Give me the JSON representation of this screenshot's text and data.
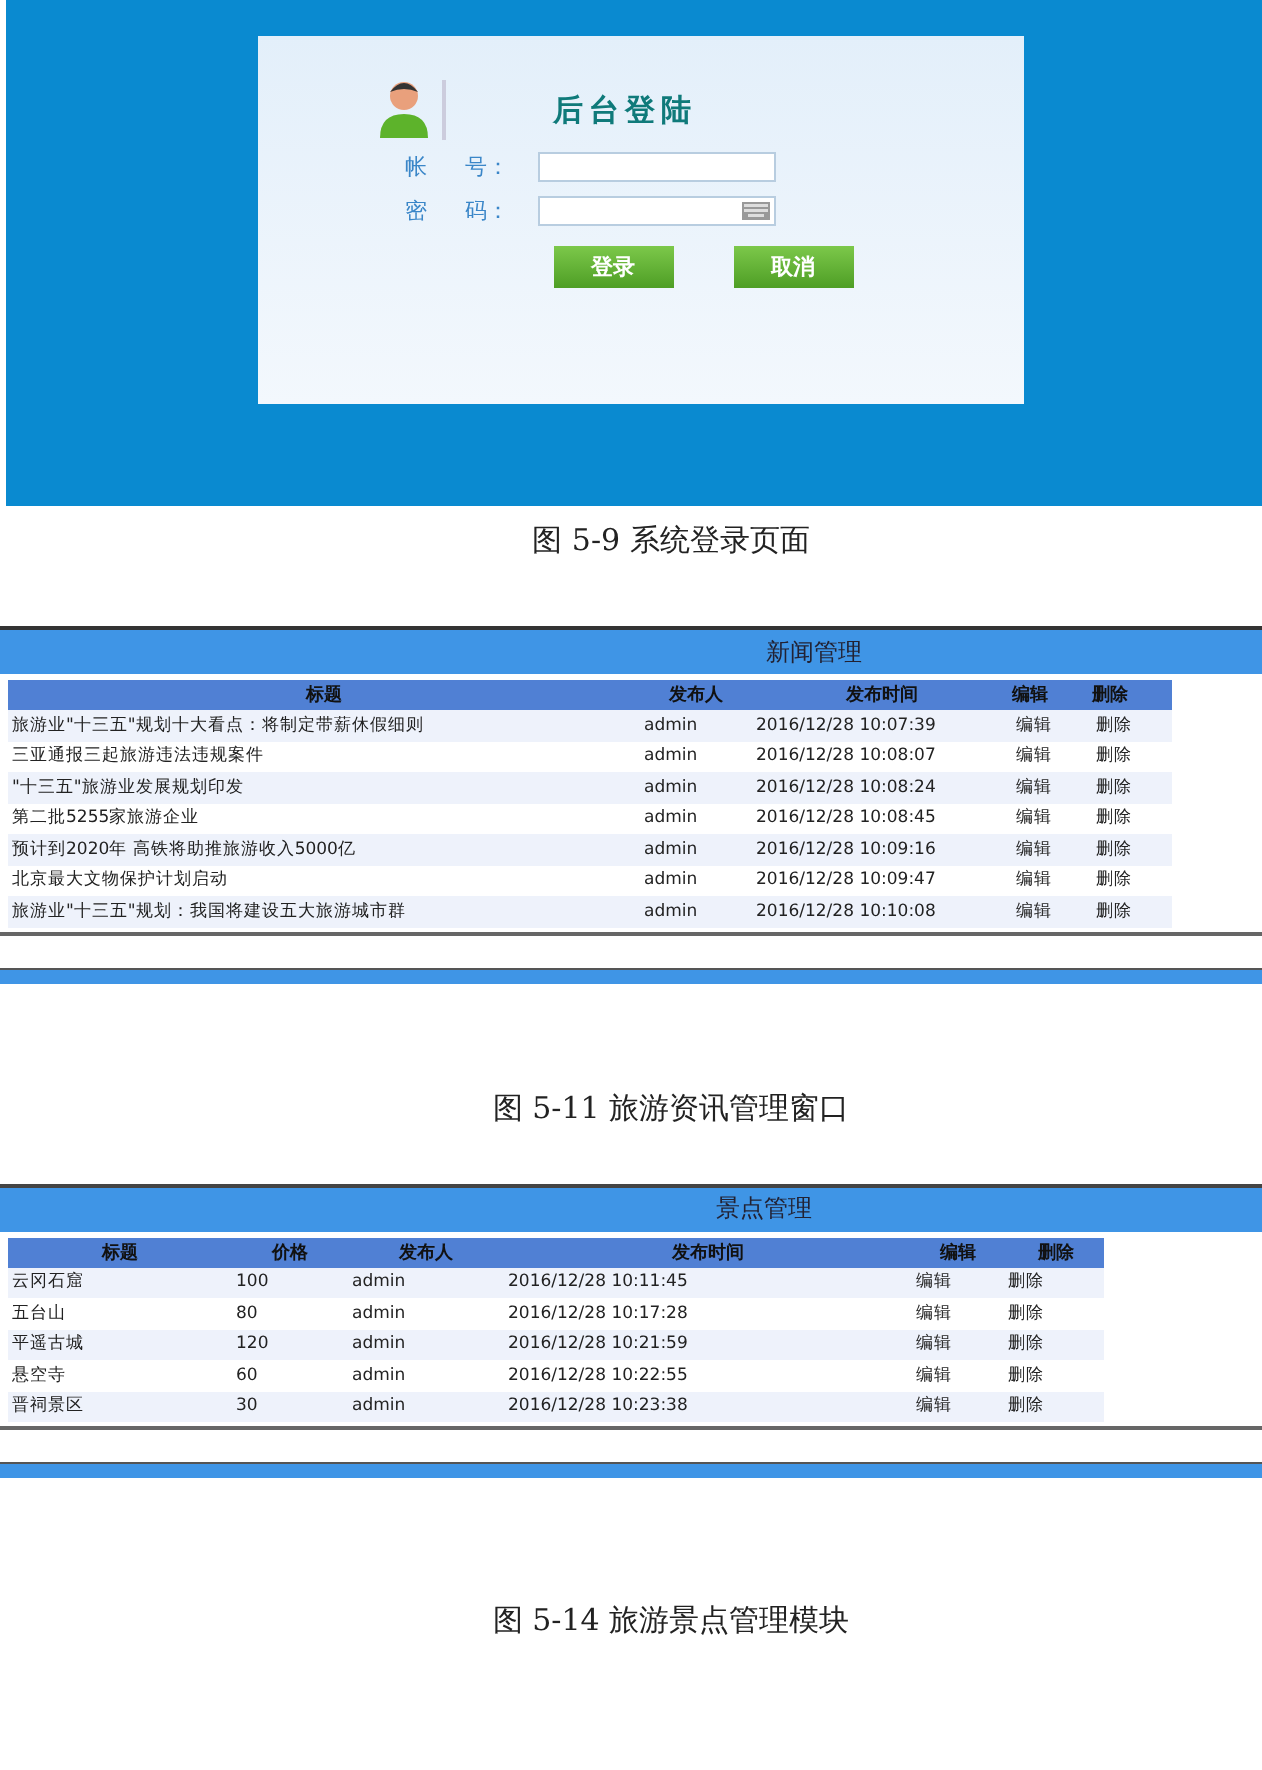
{
  "login": {
    "title": "后台登陆",
    "fields": [
      {
        "label": "帐",
        "suffix": "号：",
        "keyboard": false
      },
      {
        "label": "密",
        "suffix": "码：",
        "keyboard": true
      }
    ],
    "buttons": [
      "登录",
      "取消"
    ]
  },
  "captions": [
    "图 5-9 系统登录页面",
    "图 5-11 旅游资讯管理窗口",
    "图 5-14 旅游景点管理模块"
  ],
  "news": {
    "title": "新闻管理",
    "columns": [
      "标题",
      "发布人",
      "发布时间",
      "编辑",
      "删除"
    ],
    "rows": [
      {
        "cells": [
          "旅游业\"十三五\"规划十大看点：将制定带薪休假细则",
          "admin",
          "2016/12/28 10:07:39",
          "编辑",
          "删除"
        ]
      },
      {
        "cells": [
          "三亚通报三起旅游违法违规案件",
          "admin",
          "2016/12/28 10:08:07",
          "编辑",
          "删除"
        ]
      },
      {
        "cells": [
          "\"十三五\"旅游业发展规划印发",
          "admin",
          "2016/12/28 10:08:24",
          "编辑",
          "删除"
        ]
      },
      {
        "cells": [
          "第二批5255家旅游企业",
          "admin",
          "2016/12/28 10:08:45",
          "编辑",
          "删除"
        ]
      },
      {
        "cells": [
          "预计到2020年 高铁将助推旅游收入5000亿",
          "admin",
          "2016/12/28 10:09:16",
          "编辑",
          "删除"
        ]
      },
      {
        "cells": [
          "北京最大文物保护计划启动",
          "admin",
          "2016/12/28 10:09:47",
          "编辑",
          "删除"
        ]
      },
      {
        "cells": [
          "旅游业\"十三五\"规划：我国将建设五大旅游城市群",
          "admin",
          "2016/12/28 10:10:08",
          "编辑",
          "删除"
        ]
      }
    ]
  },
  "spots": {
    "title": "景点管理",
    "columns": [
      "标题",
      "价格",
      "发布人",
      "发布时间",
      "编辑",
      "删除"
    ],
    "rows": [
      {
        "cells": [
          "云冈石窟",
          "100",
          "admin",
          "2016/12/28 10:11:45",
          "编辑",
          "删除"
        ]
      },
      {
        "cells": [
          "五台山",
          "80",
          "admin",
          "2016/12/28 10:17:28",
          "编辑",
          "删除"
        ]
      },
      {
        "cells": [
          "平遥古城",
          "120",
          "admin",
          "2016/12/28 10:21:59",
          "编辑",
          "删除"
        ]
      },
      {
        "cells": [
          "悬空寺",
          "60",
          "admin",
          "2016/12/28 10:22:55",
          "编辑",
          "删除"
        ]
      },
      {
        "cells": [
          "晋祠景区",
          "30",
          "admin",
          "2016/12/28 10:23:38",
          "编辑",
          "删除"
        ]
      }
    ]
  }
}
